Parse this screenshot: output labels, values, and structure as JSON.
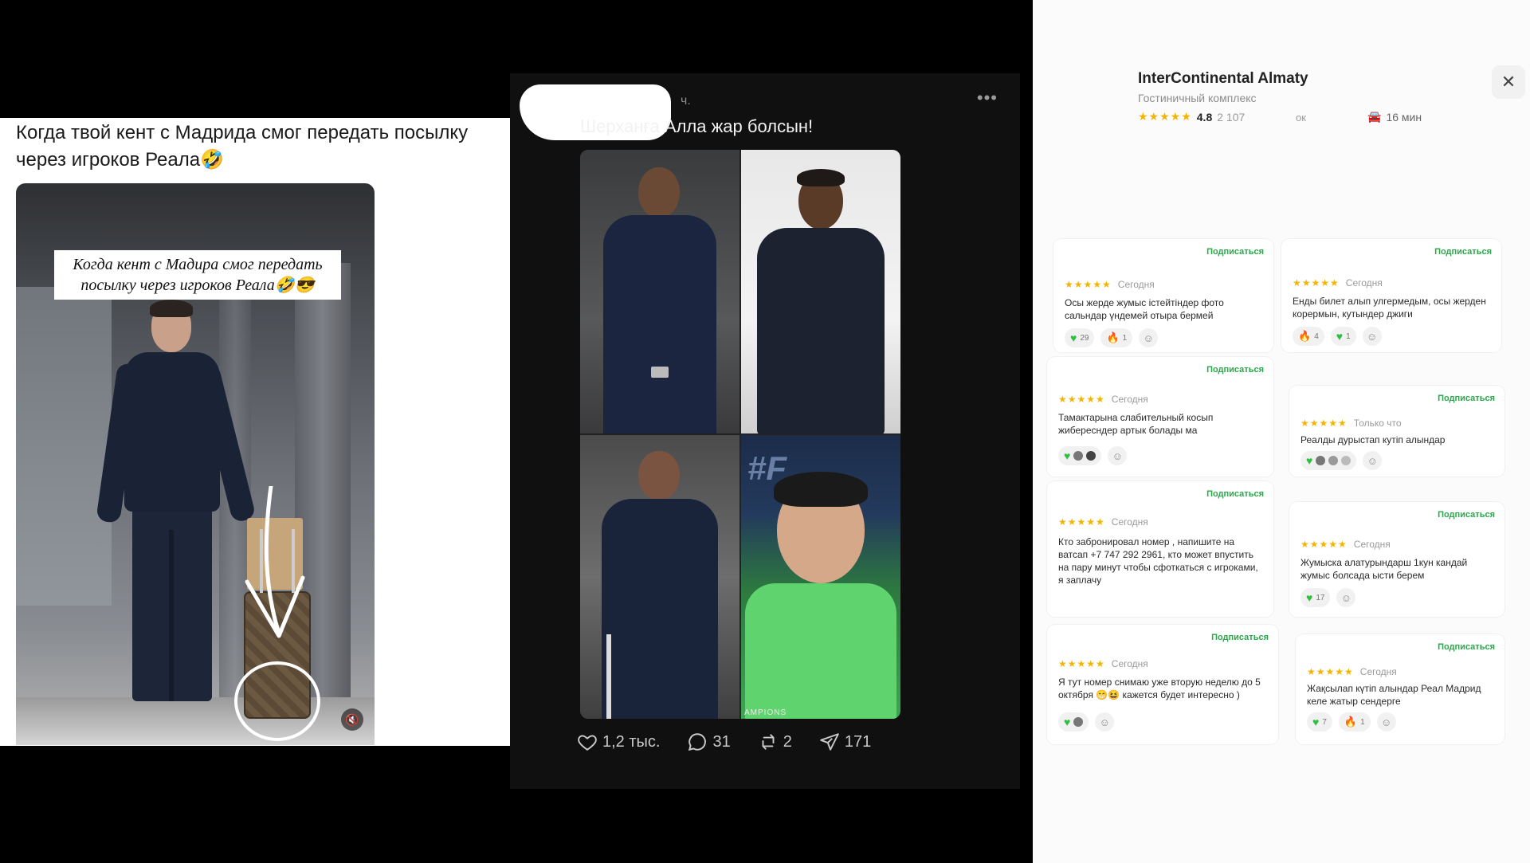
{
  "panel1": {
    "caption": "Когда твой кент с Мадрида смог передать посылку через игроков Реала🤣",
    "banner": "Когда кент с Мадира смог передать посылку через игроков Реала🤣😎",
    "mute_icon": "mute-icon"
  },
  "panel2": {
    "time": "ч.",
    "more_icon": "more-icon",
    "text": "Шерханға Алла жар болсын!",
    "tile3_overlay": "#F",
    "tile4_caption": "AMPIONS",
    "actions": {
      "likes": "1,2 тыс.",
      "comments": "31",
      "reposts": "2",
      "shares": "171"
    }
  },
  "panel3": {
    "hotel": {
      "name": "InterContinental Almaty",
      "type": "Гостиничный комплекс",
      "stars": "★★★★★",
      "rating": "4.8",
      "count": "2 107",
      "truncated": "ок",
      "drive_time": "16 мин",
      "close_icon": "close-icon"
    },
    "reviews": [
      {
        "subscribe": "Подписаться",
        "stars": "★★★★★",
        "date": "Сегодня",
        "text": "Осы жерде жумыс істейтіндер фото сальндар үндемей отыра бермей",
        "reacts": [
          "29",
          "1"
        ]
      },
      {
        "subscribe": "Подписаться",
        "stars": "★★★★★",
        "date": "Сегодня",
        "text": "Енды билет алып улгермедым, осы жерден корермын, кутындер джиги",
        "reacts": [
          "4",
          "1"
        ]
      },
      {
        "subscribe": "Подписаться",
        "stars": "★★★★★",
        "date": "Сегодня",
        "text": "Тамактарына слабительный косып жибересндер артык болады ма",
        "reacts": []
      },
      {
        "subscribe": "Подписаться",
        "stars": "★★★★★",
        "date": "Только что",
        "text": "Реалды дурыстап кутіп алындар",
        "reacts": []
      },
      {
        "subscribe": "Подписаться",
        "stars": "★★★★★",
        "date": "Сегодня",
        "text": "Кто забронировал номер , напишите на ватсап +7 747 292 2961, кто может впустить на пару минут чтобы сфоткаться с игроками, я заплачу",
        "reacts": []
      },
      {
        "subscribe": "Подписаться",
        "stars": "★★★★★",
        "date": "Сегодня",
        "text": "Жумыска алатурындарш 1кун кандай жумыс болсада ысти берем",
        "reacts": [
          "17"
        ]
      },
      {
        "subscribe": "Подписаться",
        "stars": "★★★★★",
        "date": "Сегодня",
        "text": "Я тут номер снимаю уже вторую неделю до 5 октября 😁😆 кажется будет интересно )",
        "reacts": []
      },
      {
        "subscribe": "Подписаться",
        "stars": "★★★★★",
        "date": "Сегодня",
        "text": "Жақсылап күтіп алындар Реал Мадрид келе жатыр сендерге",
        "reacts": [
          "7",
          "1"
        ]
      }
    ]
  }
}
